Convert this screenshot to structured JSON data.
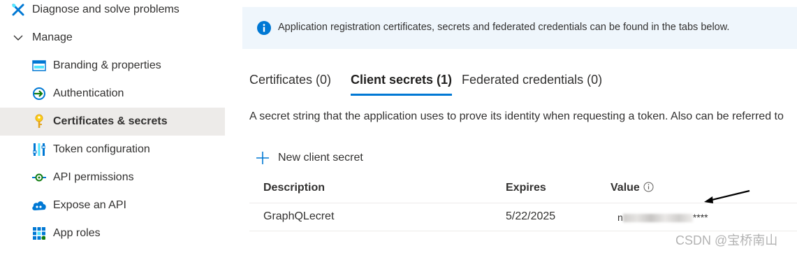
{
  "sidebar": {
    "items": [
      {
        "label": "Diagnose and solve problems",
        "icon": "wrench-icon"
      },
      {
        "label": "Manage",
        "icon": "chevron-down-icon"
      },
      {
        "label": "Branding & properties",
        "icon": "branding-icon"
      },
      {
        "label": "Authentication",
        "icon": "authentication-icon"
      },
      {
        "label": "Certificates & secrets",
        "icon": "key-icon",
        "selected": true
      },
      {
        "label": "Token configuration",
        "icon": "token-config-icon"
      },
      {
        "label": "API permissions",
        "icon": "api-permissions-icon"
      },
      {
        "label": "Expose an API",
        "icon": "cloud-icon"
      },
      {
        "label": "App roles",
        "icon": "app-roles-icon"
      }
    ]
  },
  "info": {
    "text": "Application registration certificates, secrets and federated credentials can be found in the tabs below.",
    "icon": "info-icon"
  },
  "tabs": [
    {
      "label": "Certificates (0)"
    },
    {
      "label": "Client secrets (1)",
      "active": true
    },
    {
      "label": "Federated credentials (0)"
    }
  ],
  "description": "A secret string that the application uses to prove its identity when requesting a token. Also can be referred to",
  "toolbar": {
    "new_secret_label": "New client secret"
  },
  "table": {
    "headers": [
      "Description",
      "Expires",
      "Value"
    ],
    "rows": [
      {
        "description": "GraphQLecret",
        "expires": "5/22/2025",
        "value_prefix": "n",
        "value_suffix": "****"
      }
    ]
  },
  "watermark": "CSDN @宝桥南山",
  "colors": {
    "accent": "#0078d4",
    "selected_bg": "#edebe9",
    "info_bg": "#eff6fc"
  }
}
